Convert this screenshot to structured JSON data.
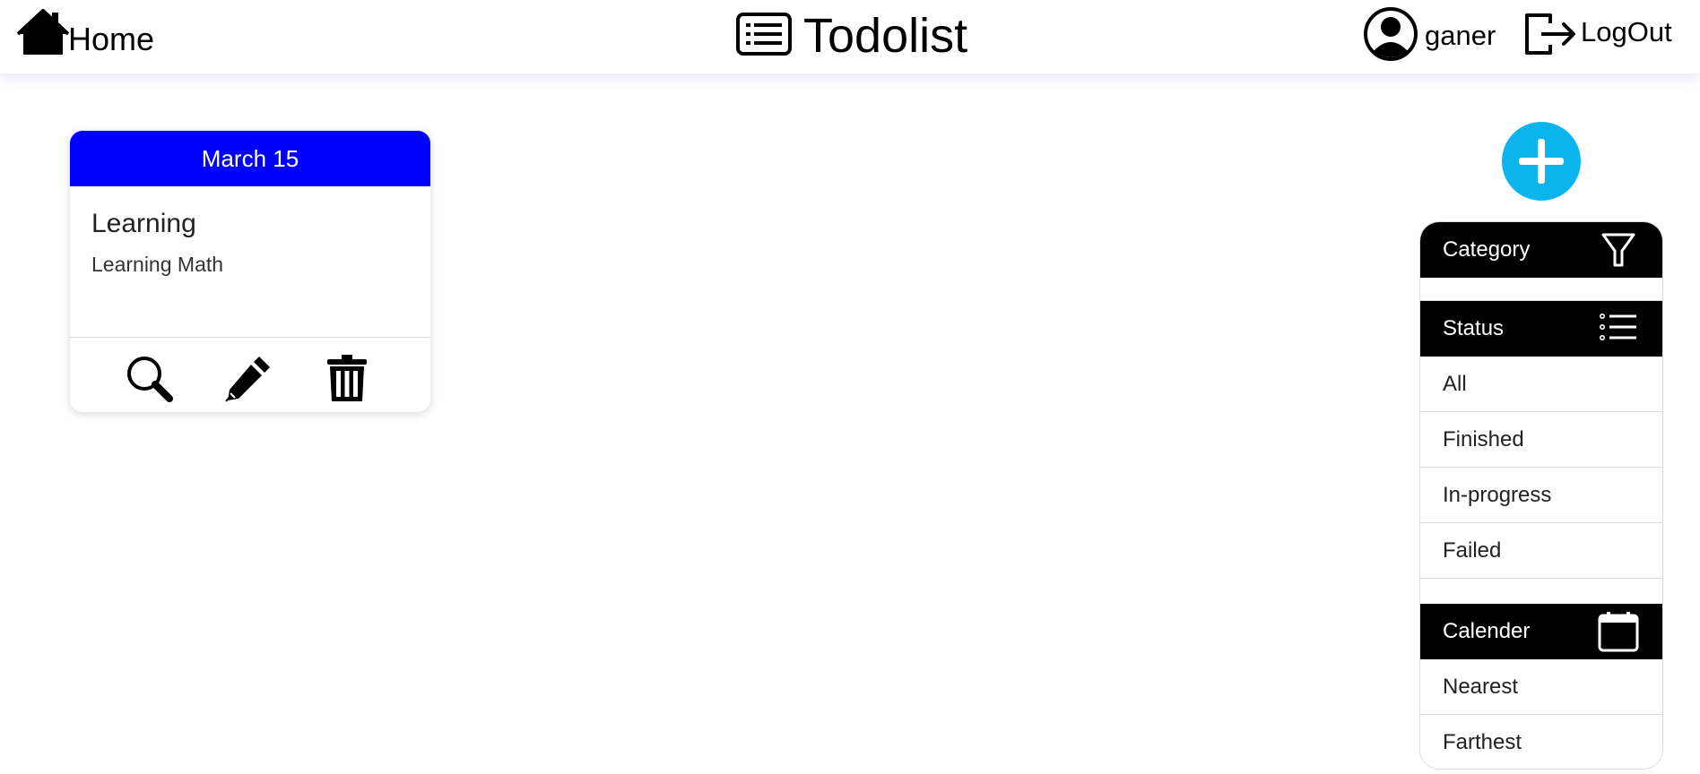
{
  "header": {
    "home_label": "Home",
    "home_icon": "house-icon",
    "app_title": "Todolist",
    "app_icon": "list-icon",
    "user_name": "ganer",
    "user_icon": "user-circle-icon",
    "logout_label": "LogOut",
    "logout_icon": "logout-icon"
  },
  "tasks": [
    {
      "date": "March 15",
      "title": "Learning",
      "description": "Learning Math",
      "actions": [
        "search-icon",
        "pencil-icon",
        "trash-icon"
      ]
    }
  ],
  "add_button_icon": "plus-icon",
  "filters": {
    "category": {
      "label": "Category",
      "icon": "filter-icon",
      "items": []
    },
    "status": {
      "label": "Status",
      "icon": "list-icon",
      "items": [
        "All",
        "Finished",
        "In-progress",
        "Failed"
      ]
    },
    "calendar": {
      "label": "Calender",
      "icon": "calendar-icon",
      "items": [
        "Nearest",
        "Farthest"
      ]
    }
  },
  "colors": {
    "card_header": "#0000ff",
    "add_button": "#0cb4ee",
    "section_header": "#000000"
  }
}
